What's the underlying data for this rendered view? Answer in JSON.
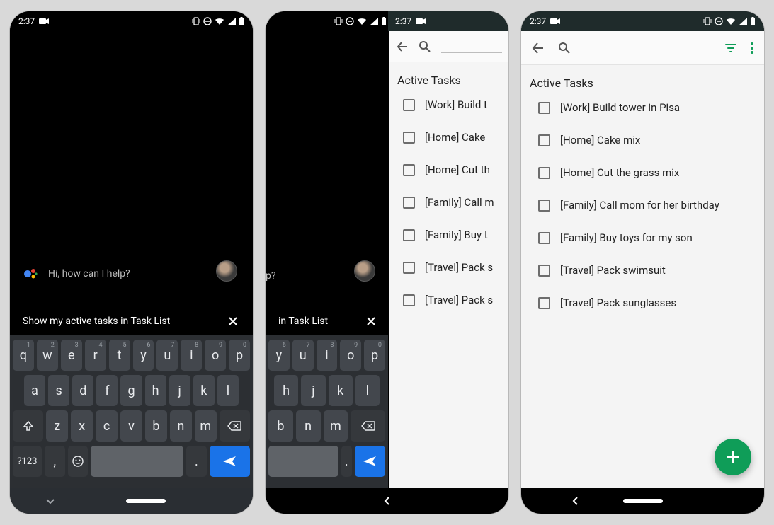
{
  "status": {
    "time": "2:37"
  },
  "assistant": {
    "prompt": "Hi, how can I help?",
    "query_full": "Show my active tasks in Task List",
    "query_partial": "in Task List"
  },
  "keyboard": {
    "row1": [
      "q",
      "w",
      "e",
      "r",
      "t",
      "y",
      "u",
      "i",
      "o",
      "p"
    ],
    "row1sup": [
      "1",
      "2",
      "3",
      "4",
      "5",
      "6",
      "7",
      "8",
      "9",
      "0"
    ],
    "row2": [
      "a",
      "s",
      "d",
      "f",
      "g",
      "h",
      "j",
      "k",
      "l"
    ],
    "row3": [
      "z",
      "x",
      "c",
      "v",
      "b",
      "n",
      "m"
    ],
    "alt_key": "?123",
    "comma": ",",
    "period": "."
  },
  "app": {
    "list_title": "Active Tasks",
    "tasks": [
      "[Work] Build tower in Pisa",
      "[Home] Cake mix",
      "[Home] Cut the grass mix",
      "[Family] Call mom for her birthday",
      "[Family] Buy toys for my son",
      "[Travel] Pack swimsuit",
      "[Travel] Pack sunglasses"
    ],
    "tasks_short": [
      "[Work] Build t",
      "[Home] Cake",
      "[Home] Cut th",
      "[Family] Call m",
      "[Family] Buy t",
      "[Travel] Pack s",
      "[Travel] Pack s"
    ]
  }
}
